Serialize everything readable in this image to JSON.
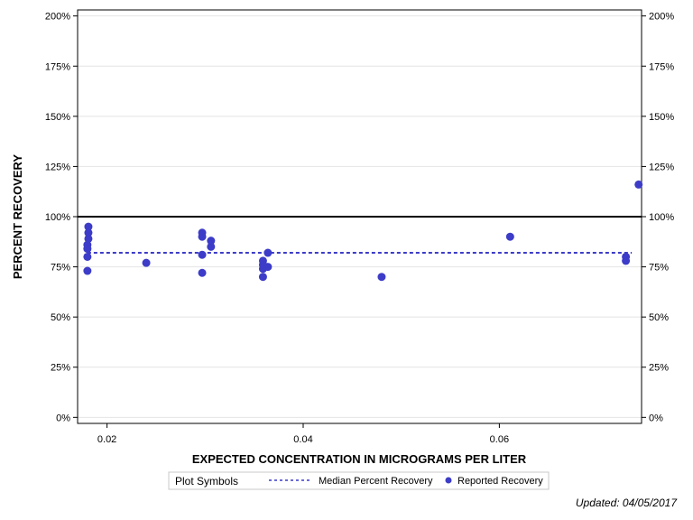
{
  "chart_data": {
    "type": "scatter",
    "xlabel": "EXPECTED CONCENTRATION IN MICROGRAMS PER LITER",
    "ylabel": "PERCENT RECOVERY",
    "xlim": [
      0.017,
      0.0745
    ],
    "ylim": [
      -3,
      203
    ],
    "x_ticks": [
      0.02,
      0.04,
      0.06
    ],
    "x_tick_labels": [
      "0.02",
      "0.04",
      "0.06"
    ],
    "y_ticks": [
      0,
      25,
      50,
      75,
      100,
      125,
      150,
      175,
      200
    ],
    "y_tick_labels": [
      "0%",
      "25%",
      "50%",
      "75%",
      "100%",
      "125%",
      "150%",
      "175%",
      "200%"
    ],
    "y_grid": true,
    "reference_line": {
      "y": 100,
      "color": "#000000"
    },
    "median_line": {
      "y": 82,
      "x_range": [
        0.018,
        0.0735
      ],
      "color": "#3c3cc8"
    },
    "series": [
      {
        "name": "Reported Recovery",
        "color": "#3c3cc8",
        "points": [
          {
            "x": 0.0181,
            "y": 95
          },
          {
            "x": 0.0181,
            "y": 92
          },
          {
            "x": 0.0181,
            "y": 89
          },
          {
            "x": 0.018,
            "y": 86
          },
          {
            "x": 0.018,
            "y": 84
          },
          {
            "x": 0.018,
            "y": 80
          },
          {
            "x": 0.018,
            "y": 73
          },
          {
            "x": 0.024,
            "y": 77
          },
          {
            "x": 0.0297,
            "y": 92
          },
          {
            "x": 0.0297,
            "y": 90
          },
          {
            "x": 0.0297,
            "y": 81
          },
          {
            "x": 0.0297,
            "y": 72
          },
          {
            "x": 0.0306,
            "y": 88
          },
          {
            "x": 0.0306,
            "y": 85
          },
          {
            "x": 0.0359,
            "y": 78
          },
          {
            "x": 0.0359,
            "y": 76
          },
          {
            "x": 0.0359,
            "y": 74
          },
          {
            "x": 0.0359,
            "y": 70
          },
          {
            "x": 0.0364,
            "y": 82
          },
          {
            "x": 0.0364,
            "y": 75
          },
          {
            "x": 0.048,
            "y": 70
          },
          {
            "x": 0.0611,
            "y": 90
          },
          {
            "x": 0.0729,
            "y": 80
          },
          {
            "x": 0.0729,
            "y": 78
          },
          {
            "x": 0.0742,
            "y": 116
          }
        ]
      }
    ],
    "legend": {
      "title": "Plot Symbols",
      "placement": "bottom-center",
      "entries": [
        {
          "label": "Median Percent Recovery",
          "symbol": "dashed-line",
          "color": "#3c3cc8"
        },
        {
          "label": "Reported Recovery",
          "symbol": "filled-circle",
          "color": "#3c3cc8"
        }
      ]
    }
  },
  "footer": {
    "updated": "Updated: 04/05/2017"
  }
}
